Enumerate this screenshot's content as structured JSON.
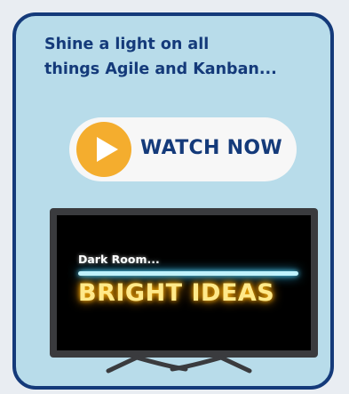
{
  "card": {
    "headline_line1": "Shine a light on all",
    "headline_line2": "things Agile and Kanban...",
    "watch_label": "WATCH NOW"
  },
  "tv": {
    "subtitle": "Dark Room...",
    "title": "BRIGHT IDEAS"
  },
  "colors": {
    "card_bg": "#b8dcea",
    "navy": "#143a7a",
    "play_orange": "#f4ad2e",
    "neon_cyan": "#bff3ff",
    "neon_yellow": "#ffe98a"
  },
  "icons": {
    "play": "play-icon"
  }
}
